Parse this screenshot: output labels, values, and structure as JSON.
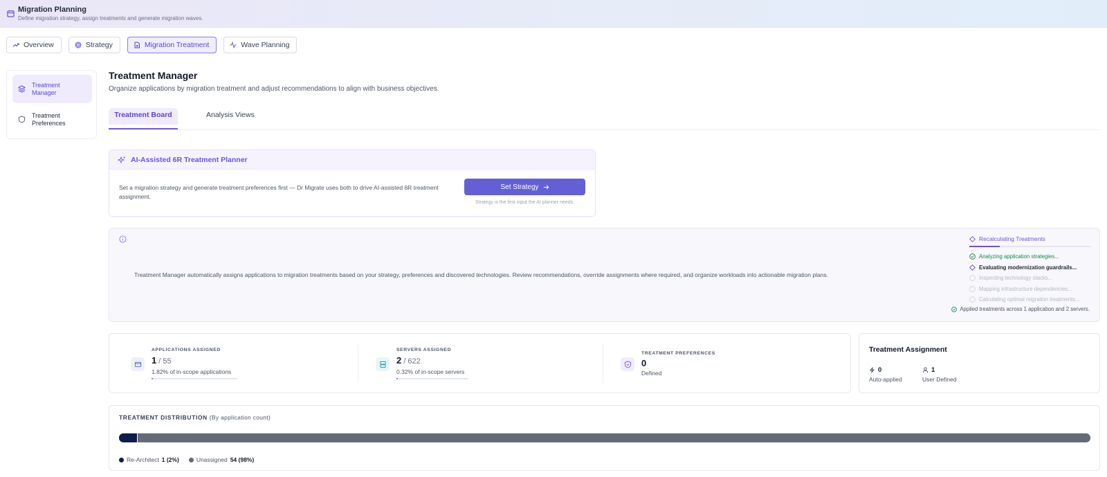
{
  "header": {
    "title": "Migration Planning",
    "subtitle": "Define migration strategy, assign treatments and generate migration waves."
  },
  "tabs": [
    {
      "label": "Overview",
      "icon": "trend-icon"
    },
    {
      "label": "Strategy",
      "icon": "target-icon"
    },
    {
      "label": "Migration Treatment",
      "icon": "document-icon",
      "active": true
    },
    {
      "label": "Wave Planning",
      "icon": "activity-icon"
    }
  ],
  "sidebar": {
    "items": [
      {
        "label": "Treatment Manager",
        "icon": "layers-icon",
        "active": true
      },
      {
        "label": "Treatment Preferences",
        "icon": "shield-icon"
      }
    ]
  },
  "page": {
    "title": "Treatment Manager",
    "subtitle": "Organize applications by migration treatment and adjust recommendations to align with business objectives."
  },
  "subtabs": [
    {
      "label": "Treatment Board",
      "active": true
    },
    {
      "label": "Analysis Views"
    }
  ],
  "ai_planner": {
    "title": "AI-Assisted 6R Treatment Planner",
    "text": "Set a migration strategy and generate treatment preferences first — Dr Migrate uses both to drive AI-assisted 6R treatment assignment.",
    "button": "Set Strategy",
    "hint": "Strategy is the first input the AI planner needs."
  },
  "info": {
    "text": "Treatment Manager automatically assigns applications to migration treatments based on your strategy, preferences and discovered technologies. Review recommendations, override assignments where required, and organize workloads into actionable migration plans.",
    "recalc_title": "Recalculating Treatments",
    "recalc_progress": 0.25,
    "steps": [
      {
        "label": "Analyzing application strategies...",
        "state": "done"
      },
      {
        "label": "Evaluating modernization guardrails...",
        "state": "current"
      },
      {
        "label": "Inspecting technology stacks...",
        "state": "pending"
      },
      {
        "label": "Mapping infrastructure dependencies...",
        "state": "pending"
      },
      {
        "label": "Calculating optimal migration treatments...",
        "state": "pending"
      }
    ],
    "note": "Applied treatments across 1 application and 2 servers."
  },
  "stats": {
    "applications": {
      "label": "APPLICATIONS ASSIGNED",
      "value": "1",
      "total": "55",
      "pct": "1.82% of in-scope applications",
      "fraction": 0.0182
    },
    "servers": {
      "label": "SERVERS ASSIGNED",
      "value": "2",
      "total": "622",
      "pct": "0.32% of in-scope servers",
      "fraction": 0.0032
    },
    "preferences": {
      "label": "TREATMENT PREFERENCES",
      "value": "0",
      "sub": "Defined"
    }
  },
  "assignment": {
    "title": "Treatment Assignment",
    "auto": {
      "value": "0",
      "label": "Auto-applied"
    },
    "user": {
      "value": "1",
      "label": "User Defined"
    }
  },
  "distribution": {
    "title": "TREATMENT DISTRIBUTION",
    "subtitle": "(By application count)",
    "segments": [
      {
        "label": "Re-Architect",
        "count_text": "1 (2%)",
        "fraction": 0.0182,
        "color": "#0f1d4a"
      },
      {
        "label": "Unassigned",
        "count_text": "54 (98%)",
        "fraction": 0.9818,
        "color": "#646b78"
      }
    ]
  },
  "colors": {
    "accent": "#6a55e0",
    "button": "#6360d6",
    "success": "#16864a"
  }
}
